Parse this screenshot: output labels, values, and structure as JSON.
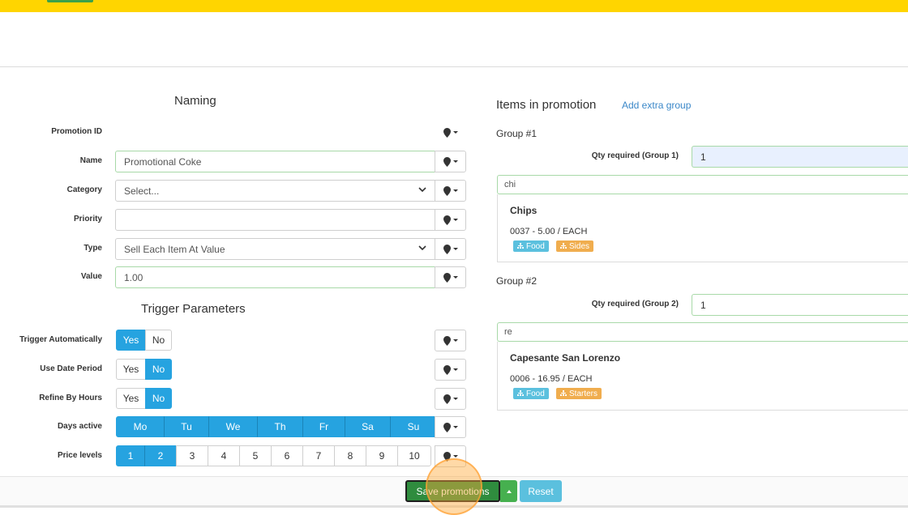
{
  "naming": {
    "title": "Naming",
    "fields": {
      "promotion_id": {
        "label": "Promotion ID",
        "value": ""
      },
      "name": {
        "label": "Name",
        "value": "Promotional Coke"
      },
      "category": {
        "label": "Category",
        "value": "Select..."
      },
      "priority": {
        "label": "Priority",
        "value": ""
      },
      "type": {
        "label": "Type",
        "value": "Sell Each Item At Value"
      },
      "value": {
        "label": "Value",
        "value": "1.00"
      }
    }
  },
  "trigger": {
    "title": "Trigger Parameters",
    "trigger_automatically": {
      "label": "Trigger Automatically",
      "yes": "Yes",
      "no": "No",
      "selected": "Yes"
    },
    "use_date_period": {
      "label": "Use Date Period",
      "yes": "Yes",
      "no": "No",
      "selected": "No"
    },
    "refine_by_hours": {
      "label": "Refine By Hours",
      "yes": "Yes",
      "no": "No",
      "selected": "No"
    },
    "days_active": {
      "label": "Days active",
      "days": [
        "Mo",
        "Tu",
        "We",
        "Th",
        "Fr",
        "Sa",
        "Su"
      ],
      "selected": [
        "Mo",
        "Tu",
        "We",
        "Th",
        "Fr",
        "Sa",
        "Su"
      ]
    },
    "price_levels": {
      "label": "Price levels",
      "levels": [
        "1",
        "2",
        "3",
        "4",
        "5",
        "6",
        "7",
        "8",
        "9",
        "10"
      ],
      "selected": [
        "1",
        "2"
      ]
    }
  },
  "items": {
    "title": "Items in promotion",
    "add_group_link": "Add extra group",
    "groups": [
      {
        "label": "Group #1",
        "qty_label": "Qty required (Group 1)",
        "qty_value": "1",
        "search": "chi",
        "result": {
          "name": "Chips",
          "meta": "0037 - 5.00 / EACH",
          "tags": [
            "Food",
            "Sides"
          ]
        }
      },
      {
        "label": "Group #2",
        "qty_label": "Qty required (Group 2)",
        "qty_value": "1",
        "search": "re",
        "result": {
          "name": "Capesante San Lorenzo",
          "meta": "0006 - 16.95 / EACH",
          "tags": [
            "Food",
            "Starters"
          ]
        }
      }
    ]
  },
  "footer": {
    "save_label": "Save promotions",
    "reset_label": "Reset"
  },
  "icons": {
    "pin": "map-pin-icon",
    "caret": "caret-down-icon",
    "tag": "sitemap-icon"
  },
  "colors": {
    "topbar": "#ffd500",
    "primary_blue": "#26a3e0",
    "save_green": "#2f8c3e",
    "reset_blue": "#5bc0de",
    "tag_food": "#5bc0de",
    "tag_category": "#f0ad4e"
  }
}
